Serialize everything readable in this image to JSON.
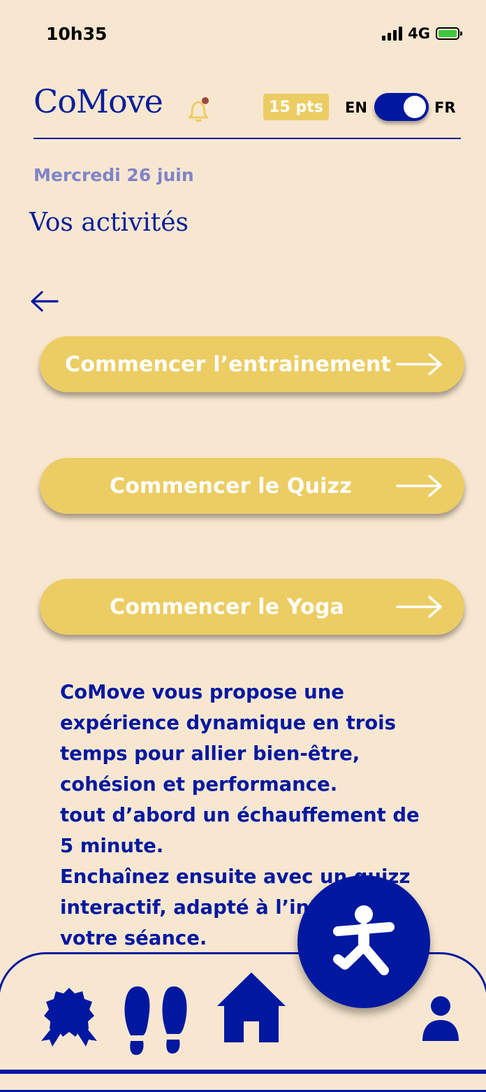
{
  "status_bar": {
    "time": "10h35",
    "network": "4G",
    "battery_color": "#3ec83e"
  },
  "header": {
    "logo": "CoMove",
    "points": "15 pts",
    "lang_left": "EN",
    "lang_right": "FR",
    "language_toggle_on": true
  },
  "page": {
    "date": "Mercredi 26 juin",
    "title": "Vos activités"
  },
  "activities": [
    {
      "label": "Commencer l’entrainement"
    },
    {
      "label": "Commencer le Quizz"
    },
    {
      "label": "Commencer le Yoga"
    }
  ],
  "description": "CoMove vous propose une\nexpérience dynamique en trois\ntemps pour allier bien-être,\ncohésion et performance.\ntout d’abord un échauffement de\n5 minute.\nEnchaînez ensuite avec un quizz\ninteractif, adapté à l’intensité de\nvotre séance.\nEnfin, terminez par du yoga",
  "nav": {
    "items": [
      "badge-icon",
      "footprints-icon",
      "home-icon",
      "yoga-icon",
      "profile-icon"
    ],
    "active": "home-icon"
  },
  "colors": {
    "primary": "#0018a0",
    "accent": "#eccd63",
    "background": "#f8e7d0",
    "muted": "#7f84c9"
  }
}
